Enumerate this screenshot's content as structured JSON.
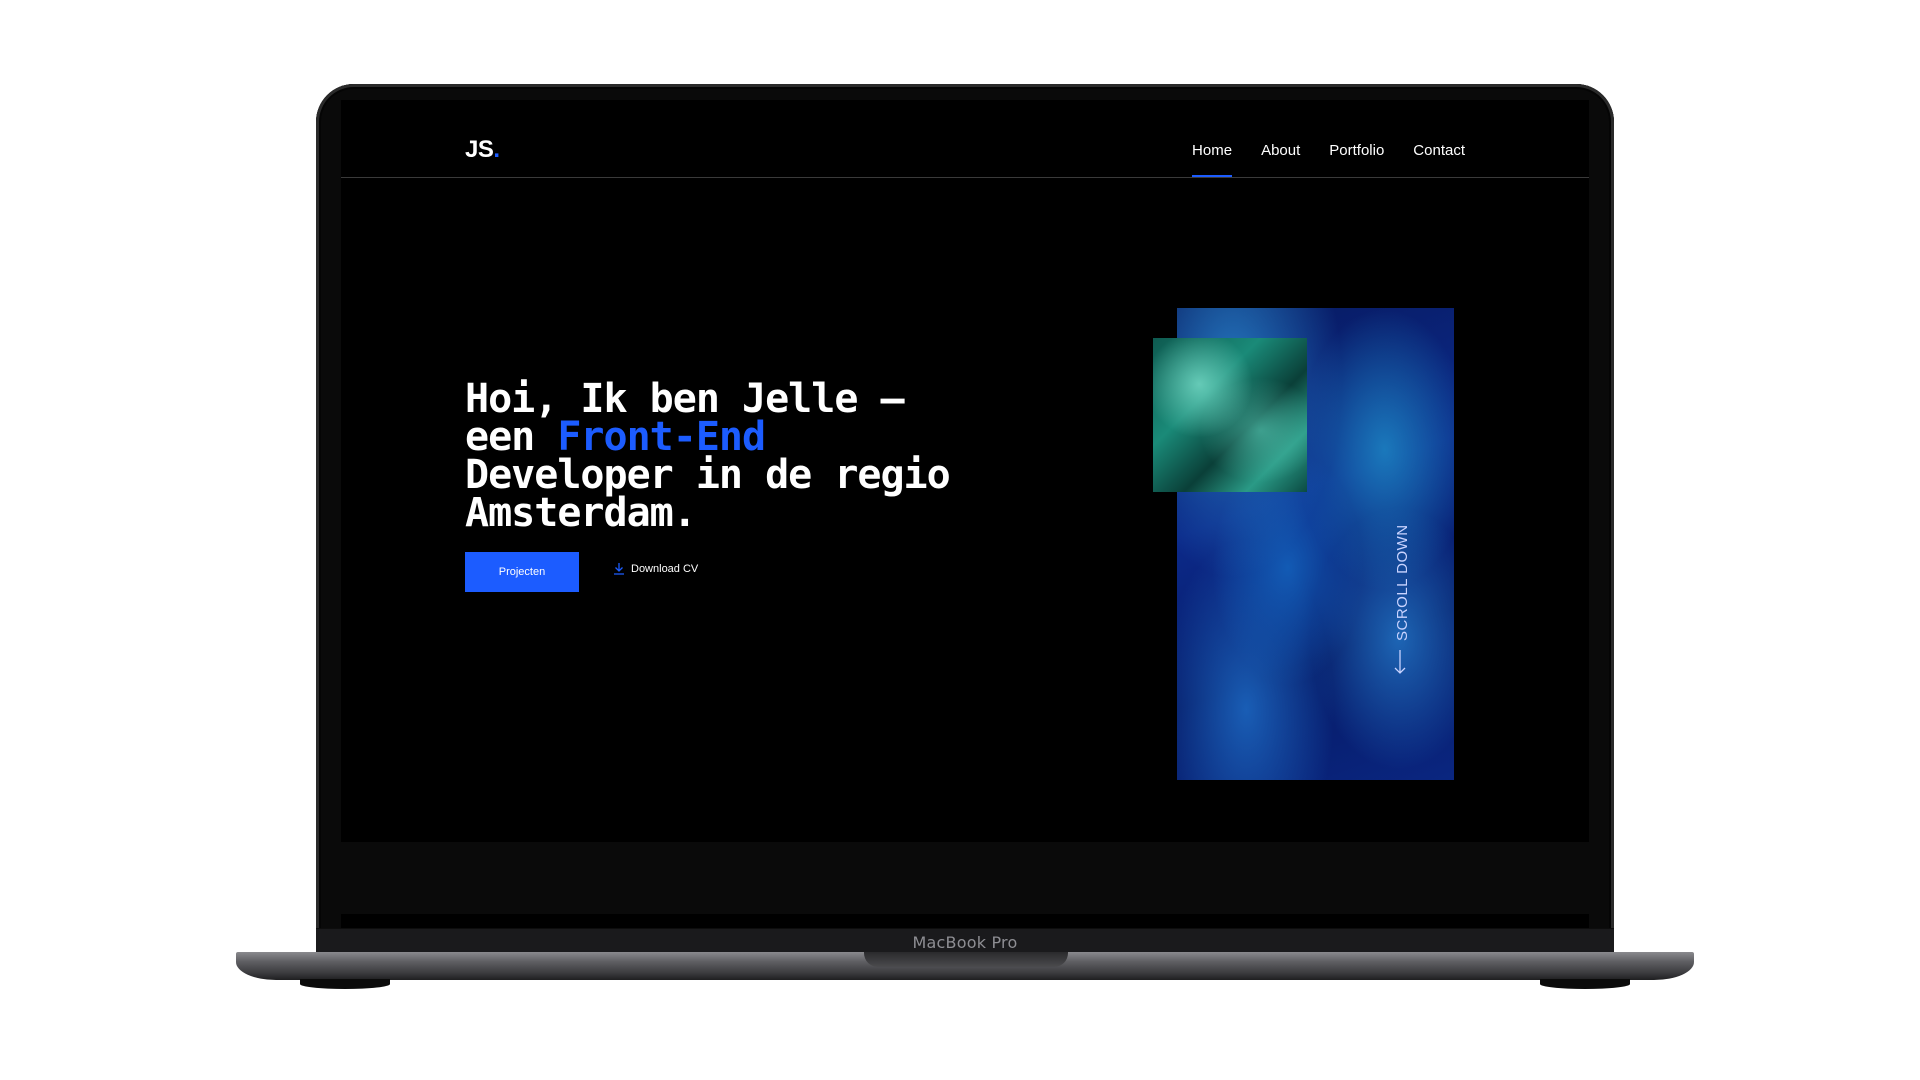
{
  "device": {
    "label": "MacBook Pro"
  },
  "site": {
    "logo": {
      "text": "JS",
      "dot": "."
    },
    "nav": [
      {
        "label": "Home",
        "active": true
      },
      {
        "label": "About",
        "active": false
      },
      {
        "label": "Portfolio",
        "active": false
      },
      {
        "label": "Contact",
        "active": false
      }
    ],
    "hero": {
      "line1": "Hoi, Ik ben Jelle —",
      "line2_prefix": "een ",
      "line2_accent": "Front-End",
      "line3": "Developer in de regio",
      "line4": "Amsterdam."
    },
    "buttons": {
      "primary": "Projecten",
      "download": "Download CV"
    },
    "scroll_label": "SCROLL DOWN"
  },
  "colors": {
    "accent": "#1c5cff",
    "background": "#000000",
    "text": "#ffffff"
  },
  "icons": {
    "download": "download-icon",
    "scroll": "arrow-down-icon"
  }
}
